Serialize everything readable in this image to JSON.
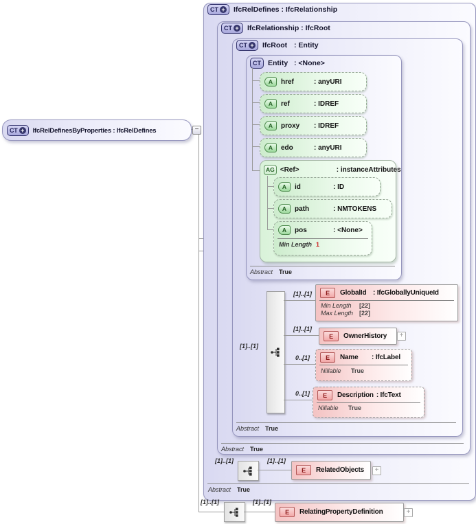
{
  "badges": {
    "complex_type": "CT",
    "attribute": "A",
    "attribute_group": "AG",
    "element": "E"
  },
  "controls": {
    "collapse": "−",
    "expand": "+",
    "plus": "+"
  },
  "colors": {
    "type_box": "#d9d9f1",
    "attribute_box": "#cdeccd",
    "element_box": "#f4c3c3",
    "facet_highlight": "#cc2020",
    "badge_navy": "#34346d",
    "badge_green": "#4c8a4c",
    "badge_red": "#b25555"
  },
  "root_element": {
    "name": "IfcRelDefinesByProperties",
    "type": " : IfcRelDefines"
  },
  "type_boxes": {
    "ifc_rel_defines": {
      "name": "IfcRelDefines",
      "type": " : IfcRelationship",
      "abstract_label": "Abstract",
      "abstract_value": "True"
    },
    "ifc_relationship": {
      "name": "IfcRelationship",
      "type": " : IfcRoot",
      "abstract_label": "Abstract",
      "abstract_value": "True"
    },
    "ifc_root": {
      "name": "IfcRoot",
      "type": ": Entity",
      "abstract_label": "Abstract",
      "abstract_value": "True"
    },
    "entity": {
      "name": "Entity",
      "type": ": <None>",
      "abstract_label": "Abstract",
      "abstract_value": "True"
    }
  },
  "entity_attributes": [
    {
      "name": "href",
      "type": ": anyURI"
    },
    {
      "name": "ref",
      "type": ": IDREF"
    },
    {
      "name": "proxy",
      "type": ": IDREF"
    },
    {
      "name": "edo",
      "type": ": anyURI"
    }
  ],
  "attribute_group": {
    "name": "<Ref>",
    "type": ": instanceAttributes",
    "attributes": [
      {
        "name": "id",
        "type": ": ID"
      },
      {
        "name": "path",
        "type": ": NMTOKENS"
      },
      {
        "name": "pos",
        "type": ": <None>",
        "facet_label": "Min Length",
        "facet_value": "1"
      }
    ]
  },
  "ifc_root_content": {
    "sequence_cardinality": "[1]..[1]",
    "elements": [
      {
        "cardinality": "[1]..[1]",
        "name": "GlobalId",
        "type": ": IfcGloballyUniqueId",
        "facets": [
          {
            "label": "Min Length",
            "value": "[22]"
          },
          {
            "label": "Max Length",
            "value": "[22]"
          }
        ]
      },
      {
        "cardinality": "[1]..[1]",
        "name": "OwnerHistory",
        "type": ""
      },
      {
        "cardinality": "0..[1]",
        "name": "Name",
        "type": ": IfcLabel",
        "facets": [
          {
            "label": "Nillable",
            "value": "True"
          }
        ]
      },
      {
        "cardinality": "0..[1]",
        "name": "Description",
        "type": ": IfcText",
        "facets": [
          {
            "label": "Nillable",
            "value": "True"
          }
        ]
      }
    ]
  },
  "ifc_rel_defines_content": {
    "sequence_cardinality": "[1]..[1]",
    "element_cardinality": "[1]..[1]",
    "element_name": "RelatedObjects"
  },
  "own_content": {
    "sequence_cardinality": "[1]..[1]",
    "element_cardinality": "[1]..[1]",
    "element_name": "RelatingPropertyDefinition"
  }
}
